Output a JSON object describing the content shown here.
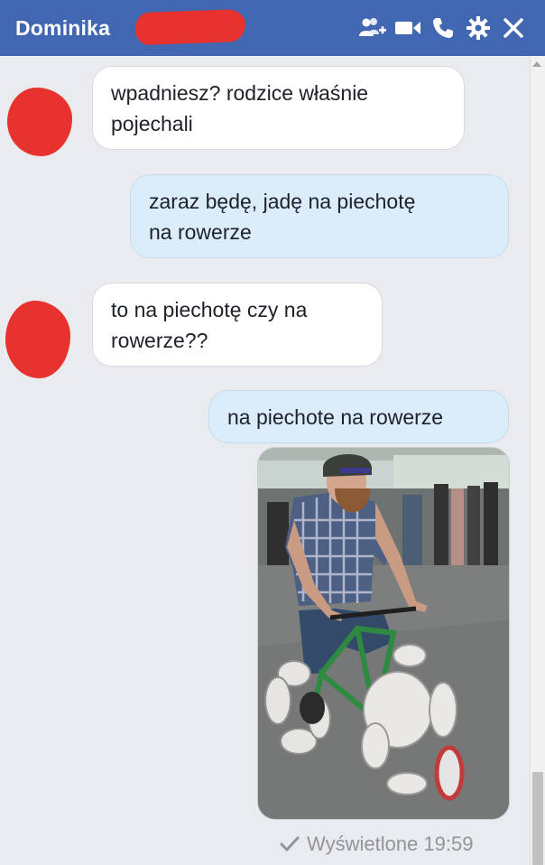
{
  "header": {
    "contact_name": "Dominika",
    "bg_color": "#4267b2",
    "icons": [
      "add-people-icon",
      "video-call-icon",
      "phone-icon",
      "gear-icon",
      "close-icon"
    ]
  },
  "messages": [
    {
      "side": "incoming",
      "text_line1": "wpadniesz? rodzice właśnie",
      "text_line2": "pojechali"
    },
    {
      "side": "outgoing",
      "text_line1": "zaraz będę, jadę na piechotę",
      "text_line2": "na rowerze"
    },
    {
      "side": "incoming",
      "text_line1": "to na piechotę czy na",
      "text_line2": "rowerze??"
    },
    {
      "side": "outgoing",
      "text_line1": "na piechote na rowerze"
    }
  ],
  "status": {
    "seen_label": "Wyświetlone 19:59"
  },
  "colors": {
    "incoming_bubble": "#ffffff",
    "outgoing_bubble": "#dbedfb",
    "redaction": "#e8322d"
  }
}
